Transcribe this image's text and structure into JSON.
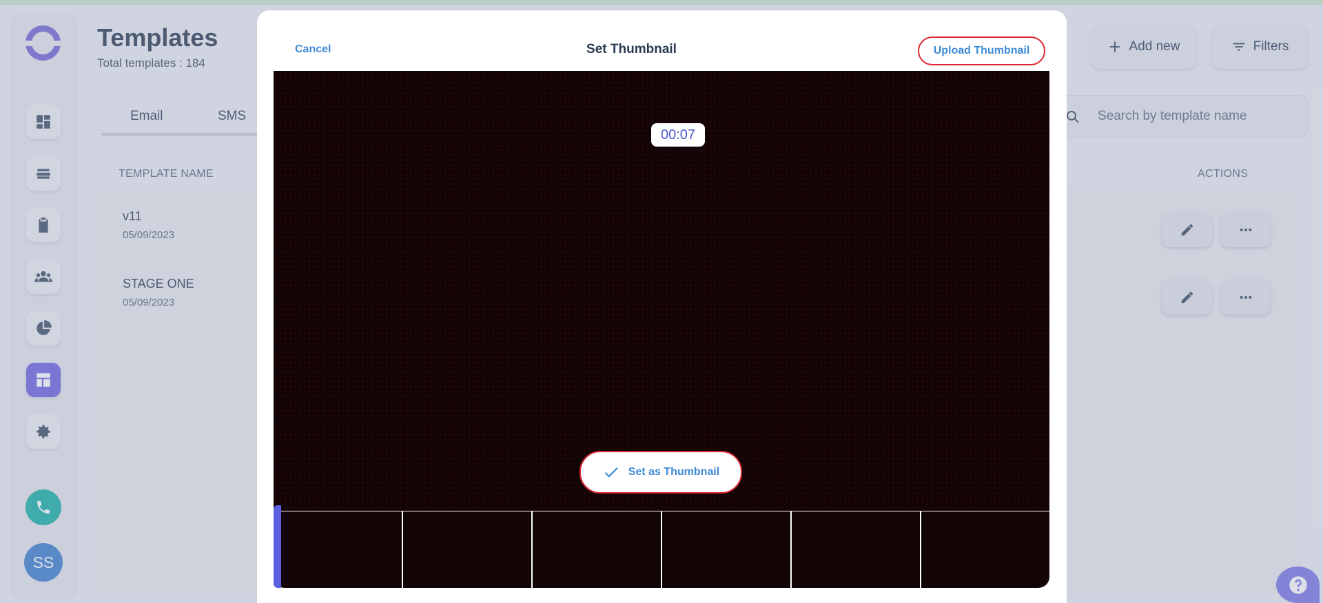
{
  "header": {
    "title": "Templates",
    "subtitle": "Total templates : 184",
    "add_new_label": "Add new",
    "filters_label": "Filters"
  },
  "tabs": [
    "Email",
    "SMS"
  ],
  "search": {
    "placeholder": "Search by template name"
  },
  "table": {
    "columns": {
      "name": "TEMPLATE NAME",
      "actions": "ACTIONS"
    },
    "rows": [
      {
        "name": "v11",
        "date": "05/09/2023"
      },
      {
        "name": "STAGE ONE",
        "date": "05/09/2023"
      }
    ]
  },
  "sidebar": {
    "items": [
      "dashboard-icon",
      "layers-icon",
      "clipboard-icon",
      "people-icon",
      "pie-chart-icon",
      "template-icon",
      "gear-icon"
    ],
    "active_item": "template-icon",
    "avatar_initials": "SS"
  },
  "modal": {
    "title": "Set Thumbnail",
    "cancel_label": "Cancel",
    "upload_label": "Upload Thumbnail",
    "timecode": "00:07",
    "set_thumbnail_label": "Set as Thumbnail",
    "frame_count": 6
  },
  "colors": {
    "accent": "#6f63e0",
    "danger_outline": "#dd2a34",
    "link": "#3f8ad6",
    "phone": "#17b3a6"
  }
}
